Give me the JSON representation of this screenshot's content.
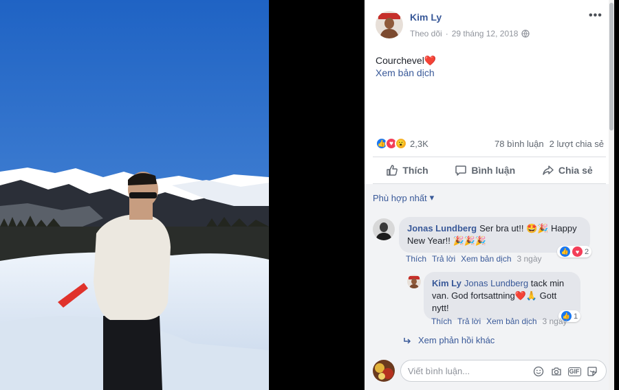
{
  "post": {
    "author": "Kim Ly",
    "follow_label": "Theo dõi",
    "separator": "·",
    "date": "29 tháng 12, 2018",
    "text": "Courchevel❤️",
    "translate_label": "Xem bản dịch",
    "more_label": "•••"
  },
  "stats": {
    "reaction_count": "2,3K",
    "comments": "78 bình luận",
    "shares": "2 lượt chia sẻ"
  },
  "actions": {
    "like": "Thích",
    "comment": "Bình luận",
    "share": "Chia sẻ"
  },
  "comments_section": {
    "sort_label": "Phù hợp nhất",
    "sort_arrow": "▾",
    "items": [
      {
        "name": "Jonas Lundberg",
        "text": "Ser bra ut!! 🤩🎉 Happy New Year!! 🎉🎉🎉",
        "actions": [
          "Thích",
          "Trả lời",
          "Xem bản dịch"
        ],
        "time": "3 ngày",
        "reaction_count": "2"
      },
      {
        "name": "Kim Ly",
        "mention": "Jonas Lundberg",
        "text": "tack min van. God fortsattning❤️🙏 Gott nytt!",
        "actions": [
          "Thích",
          "Trả lời",
          "Xem bản dịch"
        ],
        "time": "3 ngày",
        "reaction_count": "1"
      }
    ],
    "more_replies": "Xem phản hồi khác",
    "composer_placeholder": "Viết bình luận...",
    "gif_label": "GIF"
  },
  "colors": {
    "link": "#385898",
    "like_blue": "#1877f2",
    "love_red": "#f33e58",
    "wow_yellow": "#f7b125",
    "bubble": "#e4e6eb"
  },
  "icons": [
    "globe-icon",
    "thumbs-up-icon",
    "speech-bubble-icon",
    "share-arrow-icon",
    "reply-arrow-icon",
    "smiley-icon",
    "camera-icon",
    "gif-icon",
    "sticker-icon"
  ]
}
